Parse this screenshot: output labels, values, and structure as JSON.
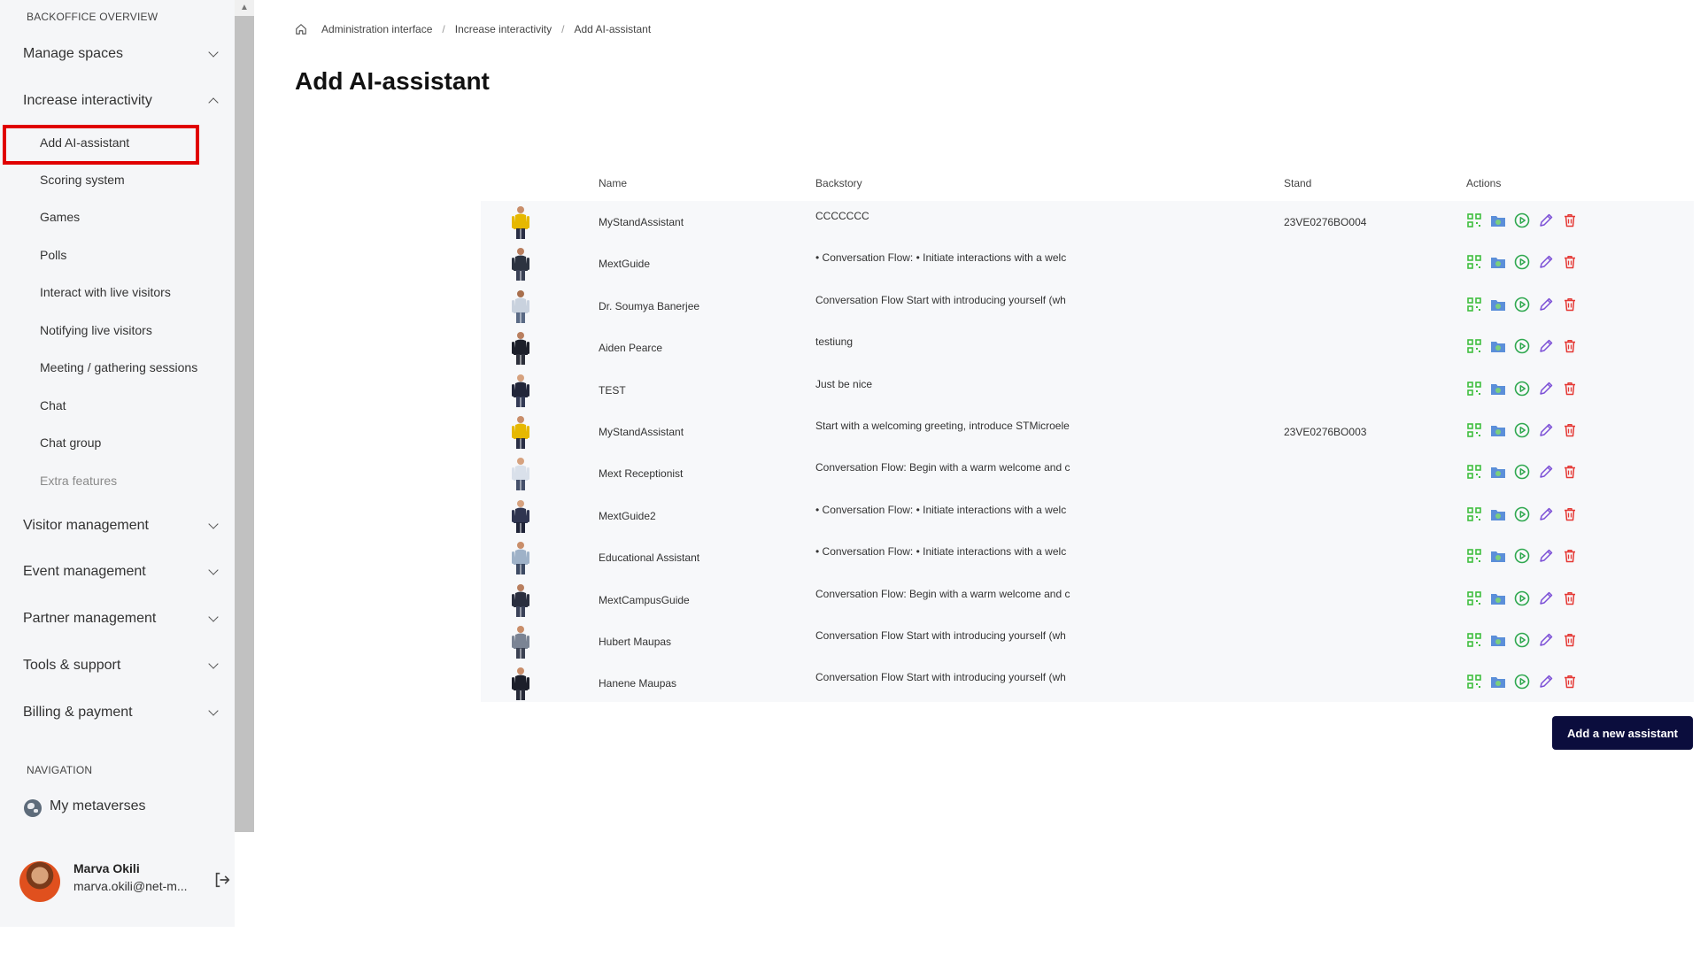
{
  "sidebar": {
    "section_overview": "BACKOFFICE OVERVIEW",
    "groups": [
      {
        "label": "Manage spaces",
        "expanded": false
      },
      {
        "label": "Increase interactivity",
        "expanded": true
      },
      {
        "label": "Visitor management",
        "expanded": false
      },
      {
        "label": "Event management",
        "expanded": false
      },
      {
        "label": "Partner management",
        "expanded": false
      },
      {
        "label": "Tools & support",
        "expanded": false
      },
      {
        "label": "Billing & payment",
        "expanded": false
      }
    ],
    "sub_items": [
      "Add AI-assistant",
      "Scoring system",
      "Games",
      "Polls",
      "Interact with live visitors",
      "Notifying live visitors",
      "Meeting / gathering sessions",
      "Chat",
      "Chat group",
      "Extra features"
    ],
    "section_navigation": "NAVIGATION",
    "my_metaverses": "My metaverses",
    "user": {
      "name": "Marva Okili",
      "email": "marva.okili@net-m..."
    }
  },
  "breadcrumb": [
    "Administration interface",
    "Increase interactivity",
    "Add AI-assistant"
  ],
  "page_title": "Add AI-assistant",
  "table": {
    "headers": {
      "name": "Name",
      "backstory": "Backstory",
      "stand": "Stand",
      "actions": "Actions"
    },
    "rows": [
      {
        "name": "MyStandAssistant",
        "backstory": "CCCCCCC",
        "stand": "23VE0276BO004",
        "avatar": {
          "top": "#e6b800",
          "bottom": "#2a2f45",
          "skin": "#c98e6a"
        }
      },
      {
        "name": "MextGuide",
        "backstory": "• Conversation Flow: • Initiate interactions with a welc",
        "stand": "",
        "avatar": {
          "top": "#2c3340",
          "bottom": "#3a4155",
          "skin": "#b97f5f"
        }
      },
      {
        "name": "Dr. Soumya Banerjee",
        "backstory": "Conversation Flow Start with introducing yourself (wh",
        "stand": "",
        "avatar": {
          "top": "#c9d2de",
          "bottom": "#5a6a85",
          "skin": "#a86f4d"
        }
      },
      {
        "name": "Aiden Pearce",
        "backstory": "testiung",
        "stand": "",
        "avatar": {
          "top": "#1c1f2a",
          "bottom": "#2c2f3a",
          "skin": "#b97f5f"
        }
      },
      {
        "name": "TEST",
        "backstory": "Just be nice",
        "stand": "",
        "avatar": {
          "top": "#22263a",
          "bottom": "#333a55",
          "skin": "#d6a27f"
        }
      },
      {
        "name": "MyStandAssistant",
        "backstory": "Start with a welcoming greeting, introduce STMicroele",
        "stand": "23VE0276BO003",
        "avatar": {
          "top": "#e6b800",
          "bottom": "#2a2f45",
          "skin": "#c98e6a"
        }
      },
      {
        "name": "Mext Receptionist",
        "backstory": "Conversation Flow: Begin with a warm welcome and c",
        "stand": "",
        "avatar": {
          "top": "#d9e0ea",
          "bottom": "#45506a",
          "skin": "#d6a27f"
        }
      },
      {
        "name": "MextGuide2",
        "backstory": "• Conversation Flow: • Initiate interactions with a welc",
        "stand": "",
        "avatar": {
          "top": "#2f3550",
          "bottom": "#1f2438",
          "skin": "#d6a27f"
        }
      },
      {
        "name": "Educational Assistant",
        "backstory": "• Conversation Flow: • Initiate interactions with a welc",
        "stand": "",
        "avatar": {
          "top": "#9fb2c8",
          "bottom": "#3d4a63",
          "skin": "#c98e6a"
        }
      },
      {
        "name": "MextCampusGuide",
        "backstory": "Conversation Flow: Begin with a warm welcome and c",
        "stand": "",
        "avatar": {
          "top": "#2a2f3f",
          "bottom": "#3a4158",
          "skin": "#b97f5f"
        }
      },
      {
        "name": "Hubert Maupas",
        "backstory": "Conversation Flow Start with introducing yourself (wh",
        "stand": "",
        "avatar": {
          "top": "#7b8494",
          "bottom": "#3b4152",
          "skin": "#c98e6a"
        }
      },
      {
        "name": "Hanene Maupas",
        "backstory": "Conversation Flow Start with introducing yourself (wh",
        "stand": "",
        "avatar": {
          "top": "#1c1f2a",
          "bottom": "#262a38",
          "skin": "#c98e6a"
        }
      }
    ],
    "action_icons": [
      "qr-code-icon",
      "folder-image-icon",
      "play-icon",
      "edit-icon",
      "delete-icon"
    ]
  },
  "add_button_label": "Add a new assistant",
  "colors": {
    "highlight": "#e00000",
    "primary_button": "#0b0d3d",
    "qr": "#3fbf3f",
    "play": "#2fa84f",
    "edit": "#7b4fd6",
    "delete": "#e53935",
    "folder": "#5b8fd9"
  }
}
